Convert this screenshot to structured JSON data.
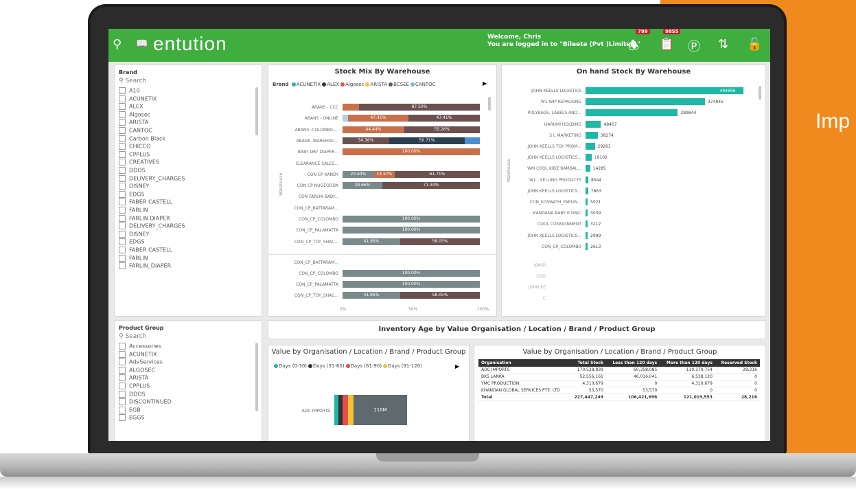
{
  "side_text": "Imp",
  "app": {
    "logo": "entution",
    "welcome_line1": "Welcome, Chris",
    "welcome_line2": "You are logged in to \"Bileeta (Pvt )Limited \"",
    "badge_notifications": "799",
    "badge_tasks": "9855"
  },
  "brand_slicer": {
    "title": "Brand",
    "search_placeholder": "Search",
    "items": [
      "A10",
      "ACUNETIX",
      "ALEX",
      "Algosec",
      "ARISTA",
      "CANTOC",
      "Carbon Black",
      "CHICCO",
      "CPPLUS",
      "CREATIVES",
      "DDOS",
      "DELIVERY_CHARGES",
      "DISNEY",
      "EDGS",
      "FABER CASTELL",
      "FARLIN",
      "FARLIN DIAPER",
      "DELIVERY_CHARGES",
      "DISNEY",
      "EDGS",
      "FABER CASTELL",
      "FARLIN",
      "FARLIN_DIAPER"
    ]
  },
  "product_slicer": {
    "title": "Product Group",
    "search_placeholder": "Search",
    "items": [
      "Accessories",
      "ACUNETIX",
      "AdvServices",
      "ALGOSEC",
      "ARISTA",
      "CPPLUS",
      "DDOS",
      "DISCONTINUED",
      "EGB",
      "EGGS"
    ]
  },
  "stock_mix": {
    "title": "Stock Mix By Warehouse",
    "legend_label": "Brand",
    "legend": [
      {
        "name": "ACUNETIX",
        "color": "#1fb8a6"
      },
      {
        "name": "ALEX",
        "color": "#333333"
      },
      {
        "name": "Algosec",
        "color": "#e84c4c"
      },
      {
        "name": "ARISTA",
        "color": "#f2c12e"
      },
      {
        "name": "BCSEE",
        "color": "#555e6e"
      },
      {
        "name": "CANTOC",
        "color": "#7fb3e0"
      }
    ],
    "axis_label": "Warehouse",
    "rows": [
      {
        "label": "ABANS - CCC",
        "segs": [
          {
            "w": 0.12,
            "c": "#c8704a",
            "t": ""
          },
          {
            "w": 0.88,
            "c": "#6b5050",
            "t": "87.50%"
          }
        ]
      },
      {
        "label": "ABANS - ONLINE",
        "segs": [
          {
            "w": 0.04,
            "c": "#a9d1ec",
            "t": ""
          },
          {
            "w": 0.44,
            "c": "#c8704a",
            "t": "47.41%"
          },
          {
            "w": 0.52,
            "c": "#6b5050",
            "t": "47.41%"
          }
        ]
      },
      {
        "label": "ABANS -COLOMBO-...",
        "segs": [
          {
            "w": 0.45,
            "c": "#c8704a",
            "t": "44.44%"
          },
          {
            "w": 0.55,
            "c": "#6b5050",
            "t": "55.26%"
          }
        ]
      },
      {
        "label": "ABANS -WAREHOU...",
        "segs": [
          {
            "w": 0.34,
            "c": "#6b5050",
            "t": "34.36%"
          },
          {
            "w": 0.55,
            "c": "#2c3e50",
            "t": "50.71%"
          },
          {
            "w": 0.11,
            "c": "#4a8fd1",
            "t": ""
          }
        ]
      },
      {
        "label": "BABY DRY DIAPER...",
        "segs": [
          {
            "w": 1.0,
            "c": "#c8704a",
            "t": "100.00%"
          }
        ]
      },
      {
        "label": "CLEARANCE SALES...",
        "segs": []
      },
      {
        "label": "CON CP KANDY",
        "segs": [
          {
            "w": 0.23,
            "c": "#7a8a8a",
            "t": "23.64%"
          },
          {
            "w": 0.15,
            "c": "#c8704a",
            "t": "14.57%"
          },
          {
            "w": 0.62,
            "c": "#6b5050",
            "t": "61.71%"
          }
        ]
      },
      {
        "label": "CON CP NUGEGODA",
        "segs": [
          {
            "w": 0.29,
            "c": "#7a8a8a",
            "t": "28.66%"
          },
          {
            "w": 0.71,
            "c": "#6b5050",
            "t": "71.34%"
          }
        ]
      },
      {
        "label": "CON FARLIN BABY...",
        "segs": []
      },
      {
        "label": "CON_CP_BATTARAM...",
        "segs": []
      },
      {
        "label": "CON_CP_COLOMBO",
        "segs": [
          {
            "w": 1.0,
            "c": "#7a8a8a",
            "t": "100.00%"
          }
        ]
      },
      {
        "label": "CON_CP_PALAMATTA",
        "segs": [
          {
            "w": 1.0,
            "c": "#7a8a8a",
            "t": "100.00%"
          }
        ]
      },
      {
        "label": "CON_CP_TOY_SHAC...",
        "segs": [
          {
            "w": 0.42,
            "c": "#7a8a8a",
            "t": "41.95%"
          },
          {
            "w": 0.58,
            "c": "#6b5050",
            "t": "58.05%"
          }
        ]
      }
    ],
    "rows2": [
      {
        "label": "CON_CP_BATTARAM...",
        "segs": []
      },
      {
        "label": "CON_CP_COLOMBO",
        "segs": [
          {
            "w": 1.0,
            "c": "#7a8a8a",
            "t": "100.00%"
          }
        ]
      },
      {
        "label": "CON_CP_PALAMATTA",
        "segs": [
          {
            "w": 1.0,
            "c": "#7a8a8a",
            "t": "100.00%"
          }
        ]
      },
      {
        "label": "CON_CP_TOY_SHAC...",
        "segs": [
          {
            "w": 0.42,
            "c": "#7a8a8a",
            "t": "41.95%"
          },
          {
            "w": 0.58,
            "c": "#6b5050",
            "t": "58.05%"
          }
        ]
      }
    ],
    "ticks": [
      "0%",
      "50%",
      "100%"
    ]
  },
  "onhand": {
    "title": "On hand Stock By Warehouse",
    "axis_label": "Warehouse",
    "max": 500000,
    "rows": [
      {
        "label": "JOHN KEELLS LOGISTICS",
        "value": 494696,
        "text": "494696"
      },
      {
        "label": "W1 WIP REPACKING",
        "value": 374845,
        "text": "374845"
      },
      {
        "label": "POLYBAGS, LABELS AND...",
        "value": 289844,
        "text": "289844"
      },
      {
        "label": "HARUMI HOLDING",
        "value": 48407,
        "text": "48407"
      },
      {
        "label": "S L MARKETING",
        "value": 38274,
        "text": "38274"
      },
      {
        "label": "JOHN KEELLS TOY PROM...",
        "value": 29263,
        "text": "29263"
      },
      {
        "label": "JOHN KEELLS LOGISTICS...",
        "value": 19102,
        "text": "19102"
      },
      {
        "label": "WM COOL KIDZ BAMBAL...",
        "value": 14285,
        "text": "14285"
      },
      {
        "label": "W1 - SELLING PRODUCTS",
        "value": 8544,
        "text": "8544"
      },
      {
        "label": "JOHN KEELLS LOGISTICS...",
        "value": 7863,
        "text": "7863"
      },
      {
        "label": "CON_KOSWATH_FARLIN...",
        "value": 5021,
        "text": "5021"
      },
      {
        "label": "KANDANA BABY ICONIC",
        "value": 3039,
        "text": "3039"
      },
      {
        "label": "COOL CONSIGNMENT",
        "value": 3212,
        "text": "3212"
      },
      {
        "label": "JOHN KEELLS LOGISTICS...",
        "value": 2999,
        "text": "2999"
      },
      {
        "label": "CON_CP_COLOMBO",
        "value": 2613,
        "text": "2613"
      }
    ],
    "faded_rows": [
      "KAND",
      "COO",
      "JOHN KE",
      "C"
    ]
  },
  "inventory_age": {
    "title": "Inventory Age by Value Organisation / Location / Brand / Product Group"
  },
  "value_chart": {
    "title": "Value by Organisation / Location / Brand / Product Group",
    "legend": [
      {
        "name": "Days (0-30)",
        "color": "#1fb8a6"
      },
      {
        "name": "Days (31-60)",
        "color": "#333333"
      },
      {
        "name": "Days (61-90)",
        "color": "#e84c4c"
      },
      {
        "name": "Days (91-120)",
        "color": "#f2c12e"
      }
    ],
    "row_label": "ADC IMPORTS",
    "value_label": "110M"
  },
  "value_table": {
    "title": "Value by Organisation / Location / Brand / Product Group",
    "headers": [
      "Organisation",
      "Total Stock",
      "Less than 120 days",
      "More than 120 days",
      "Reserved Stock"
    ],
    "rows": [
      [
        "ADC IMPORTS",
        "170,528,839",
        "60,358,085",
        "110,170,754",
        "28,216"
      ],
      [
        "BKS LANKA",
        "52,556,161",
        "46,016,041",
        "6,538,120",
        "0"
      ],
      [
        "YMC PRODUCTION",
        "4,310,679",
        "0",
        "4,310,679",
        "0"
      ],
      [
        "KHANDAN GLOBAL SERVICES PTE. LTD",
        "53,570",
        "53,570",
        "0",
        "0"
      ],
      [
        "Total",
        "227,447,249",
        "106,421,696",
        "121,019,553",
        "28,216"
      ]
    ]
  }
}
